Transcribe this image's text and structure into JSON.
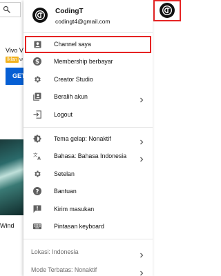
{
  "background": {
    "video_title": "Vivo V",
    "ad_badge": "Iklan",
    "ad_badge_tail": "w",
    "cta_button": "GET",
    "thumbnail_caption": "Wind"
  },
  "account": {
    "name": "CodingT",
    "email": "codingt4@gmail.com"
  },
  "menu": {
    "group1": [
      {
        "label": "Channel saya",
        "icon": "person-box-icon"
      },
      {
        "label": "Membership berbayar",
        "icon": "dollar-circle-icon"
      },
      {
        "label": "Creator Studio",
        "icon": "gear-icon"
      },
      {
        "label": "Beralih akun",
        "icon": "switch-account-icon"
      },
      {
        "label": "Logout",
        "icon": "logout-icon"
      }
    ],
    "group2": [
      {
        "label": "Tema gelap: Nonaktif",
        "icon": "dark-theme-icon"
      },
      {
        "label": "Bahasa: Bahasa Indonesia",
        "icon": "translate-icon"
      },
      {
        "label": "Setelan",
        "icon": "gear-icon"
      },
      {
        "label": "Bantuan",
        "icon": "help-icon"
      },
      {
        "label": "Kirim masukan",
        "icon": "feedback-icon"
      },
      {
        "label": "Pintasan keyboard",
        "icon": "keyboard-icon"
      }
    ],
    "group3": [
      {
        "label": "Lokasi: Indonesia"
      },
      {
        "label": "Mode Terbatas: Nonaktif"
      }
    ]
  },
  "colors": {
    "highlight": "#e52323",
    "icon": "#606060",
    "brand_blue": "#065fd4"
  }
}
